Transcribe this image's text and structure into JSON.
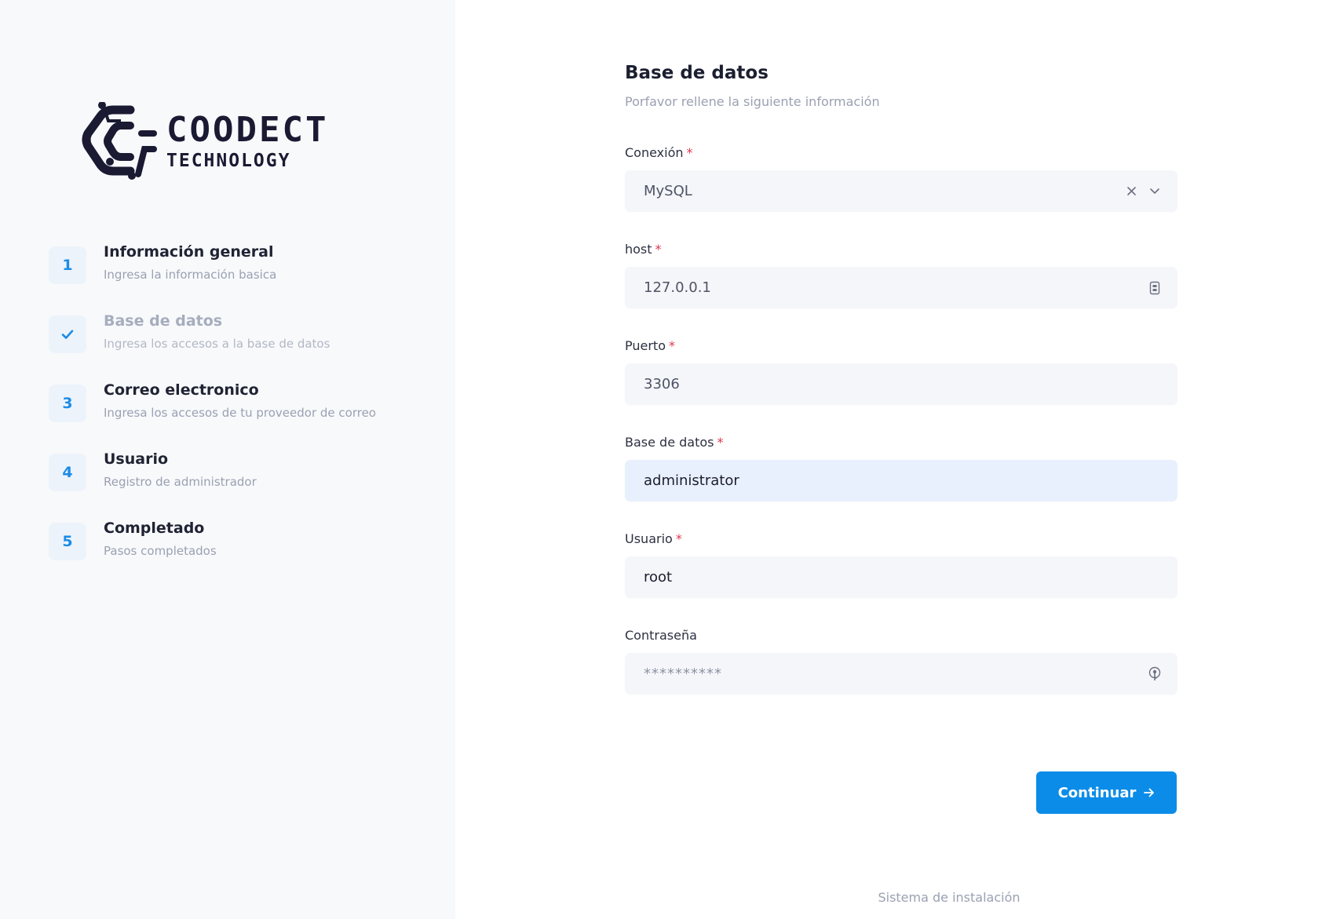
{
  "brand": {
    "name": "COODECT",
    "tagline": "TECHNOLOGY"
  },
  "steps": [
    {
      "badge": "1",
      "title": "Información general",
      "description": "Ingresa la información basica",
      "state": "pending"
    },
    {
      "badge": "",
      "title": "Base de datos",
      "description": "Ingresa los accesos a la base de datos",
      "state": "done"
    },
    {
      "badge": "3",
      "title": "Correo electronico",
      "description": "Ingresa los accesos de tu proveedor de correo",
      "state": "pending"
    },
    {
      "badge": "4",
      "title": "Usuario",
      "description": "Registro de administrador",
      "state": "pending"
    },
    {
      "badge": "5",
      "title": "Completado",
      "description": "Pasos completados",
      "state": "pending"
    }
  ],
  "form": {
    "title": "Base de datos",
    "subtitle": "Porfavor rellene la siguiente información",
    "fields": {
      "connection": {
        "label": "Conexión",
        "required_mark": "*",
        "value": "MySQL"
      },
      "host": {
        "label": "host",
        "required_mark": "*",
        "value": "127.0.0.1"
      },
      "port": {
        "label": "Puerto",
        "required_mark": "*",
        "value": "3306"
      },
      "database": {
        "label": "Base de datos",
        "required_mark": "*",
        "value": "administrator"
      },
      "user": {
        "label": "Usuario",
        "required_mark": "*",
        "value": "root"
      },
      "password": {
        "label": "Contraseña",
        "value": "**********"
      }
    },
    "continue_label": "Continuar"
  },
  "footer": {
    "text": "Sistema de instalación"
  },
  "colors": {
    "accent": "#0b8ce8",
    "required": "#e0364e",
    "sidebar_bg": "#f8f9fb",
    "input_bg": "#f5f6f9",
    "input_active_bg": "#e9f0fd"
  }
}
